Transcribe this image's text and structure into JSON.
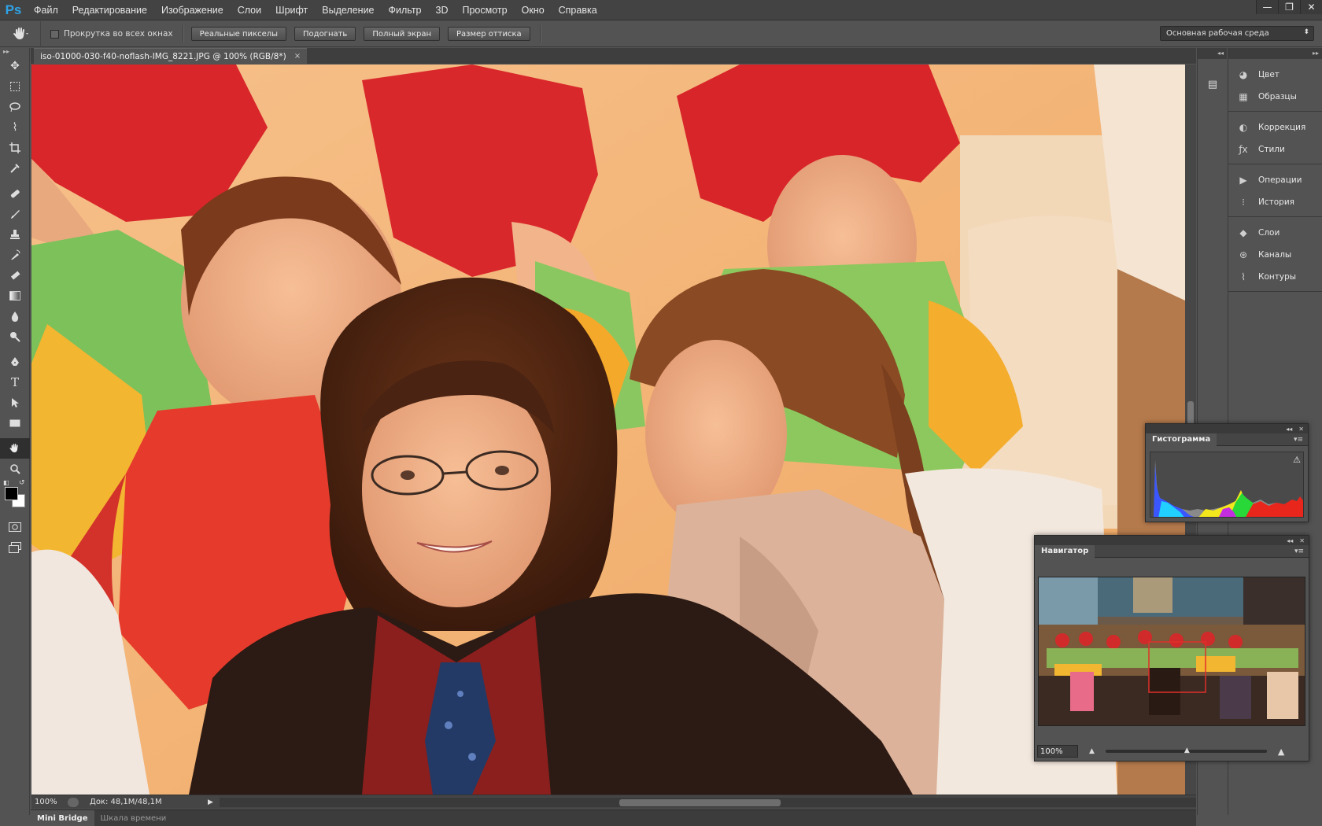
{
  "app": {
    "logo": "Ps",
    "menu": [
      "Файл",
      "Редактирование",
      "Изображение",
      "Слои",
      "Шрифт",
      "Выделение",
      "Фильтр",
      "3D",
      "Просмотр",
      "Окно",
      "Справка"
    ],
    "window_controls": [
      "—",
      "❐",
      "✕"
    ]
  },
  "options_bar": {
    "scroll_all_label": "Прокрутка во всех окнах",
    "buttons": [
      "Реальные пикселы",
      "Подогнать",
      "Полный экран",
      "Размер оттиска"
    ],
    "workspace": "Основная рабочая среда"
  },
  "document": {
    "tab_title": "iso-01000-030-f40-noflash-IMG_8221.JPG @ 100% (RGB/8*)",
    "close": "×"
  },
  "status_bar": {
    "zoom": "100%",
    "doc_info": "Док: 48,1M/48,1M"
  },
  "bottom_tabs": [
    "Mini Bridge",
    "Шкала времени"
  ],
  "dock": {
    "groups": [
      [
        {
          "label": "Цвет",
          "icon": "palette-icon"
        },
        {
          "label": "Образцы",
          "icon": "swatches-icon"
        }
      ],
      [
        {
          "label": "Коррекция",
          "icon": "adjustments-icon"
        },
        {
          "label": "Стили",
          "icon": "styles-icon"
        }
      ],
      [
        {
          "label": "Операции",
          "icon": "actions-play-icon"
        },
        {
          "label": "История",
          "icon": "history-icon"
        }
      ],
      [
        {
          "label": "Слои",
          "icon": "layers-icon"
        },
        {
          "label": "Каналы",
          "icon": "channels-icon"
        },
        {
          "label": "Контуры",
          "icon": "paths-icon"
        }
      ]
    ]
  },
  "histogram_panel": {
    "title": "Гистограмма",
    "warning": "⚠"
  },
  "navigator_panel": {
    "title": "Навигатор",
    "zoom": "100%",
    "zoom_level": 1.0
  }
}
